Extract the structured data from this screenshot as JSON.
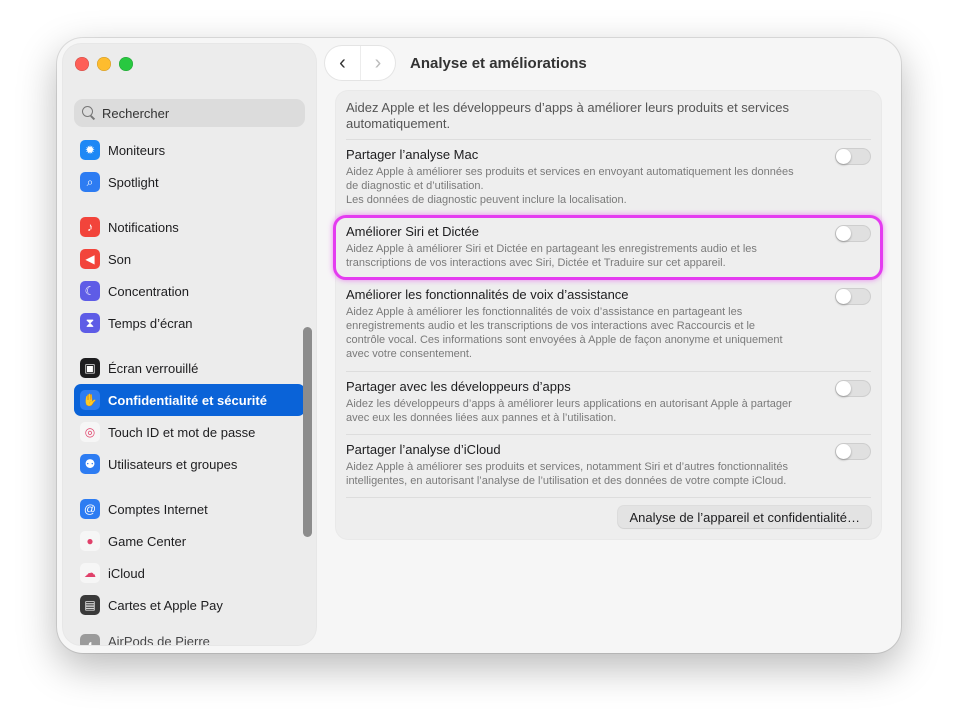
{
  "window": {
    "title": "Analyse et améliorations"
  },
  "search": {
    "placeholder": "Rechercher"
  },
  "sidebar": {
    "groups": [
      [
        {
          "label": "Moniteurs",
          "icon": "sun-icon",
          "color": "#1e88f5",
          "glyph": "✹"
        },
        {
          "label": "Spotlight",
          "icon": "spotlight-icon",
          "color": "#2d7cf2",
          "glyph": "⌕"
        }
      ],
      [
        {
          "label": "Notifications",
          "icon": "bell-icon",
          "color": "#f2443b",
          "glyph": "♪"
        },
        {
          "label": "Son",
          "icon": "speaker-icon",
          "color": "#f2443b",
          "glyph": "◀"
        },
        {
          "label": "Concentration",
          "icon": "moon-icon",
          "color": "#5e5ce6",
          "glyph": "☾"
        },
        {
          "label": "Temps d’écran",
          "icon": "hourglass-icon",
          "color": "#5e5ce6",
          "glyph": "⧗"
        }
      ],
      [
        {
          "label": "Écran verrouillé",
          "icon": "lock-icon",
          "color": "#1d1d1f",
          "glyph": "▣"
        },
        {
          "label": "Confidentialité et sécurité",
          "icon": "hand-icon",
          "color": "#2d7cf2",
          "glyph": "✋",
          "selected": true
        },
        {
          "label": "Touch ID et mot de passe",
          "icon": "fingerprint-icon",
          "color": "#f6f6f6",
          "glyph": "◎"
        },
        {
          "label": "Utilisateurs et groupes",
          "icon": "users-icon",
          "color": "#2d7cf2",
          "glyph": "⚉"
        }
      ],
      [
        {
          "label": "Comptes Internet",
          "icon": "at-icon",
          "color": "#2d7cf2",
          "glyph": "@"
        },
        {
          "label": "Game Center",
          "icon": "game-center-icon",
          "color": "#f6f6f6",
          "glyph": "●"
        },
        {
          "label": "iCloud",
          "icon": "cloud-icon",
          "color": "#f6f6f6",
          "glyph": "☁"
        },
        {
          "label": "Cartes et Apple Pay",
          "icon": "wallet-icon",
          "color": "#3a3a3a",
          "glyph": "▤"
        }
      ]
    ],
    "partial_item": {
      "label": "AirPods de Pierre",
      "icon": "airpods-icon",
      "color": "#888888",
      "glyph": "◖"
    }
  },
  "content": {
    "intro": "Aidez Apple et les développeurs d’apps à améliorer leurs produits et services automatiquement.",
    "rows": [
      {
        "title": "Partager l’analyse Mac",
        "desc": "Aidez Apple à améliorer ses produits et services en envoyant automatiquement les données de diagnostic et d’utilisation.\nLes données de diagnostic peuvent inclure la localisation.",
        "enabled": false
      },
      {
        "title": "Améliorer Siri et Dictée",
        "desc": "Aidez Apple à améliorer Siri et Dictée en partageant les enregistrements audio et les transcriptions de vos interactions avec Siri, Dictée et Traduire sur cet appareil.",
        "enabled": false
      },
      {
        "title": "Améliorer les fonctionnalités de voix d’assistance",
        "desc": "Aidez Apple à améliorer les fonctionnalités de voix d’assistance en partageant les enregistrements audio et les transcriptions de vos interactions avec Raccourcis et le contrôle vocal. Ces informations sont envoyées à Apple de façon anonyme et uniquement avec votre consentement.",
        "enabled": false
      },
      {
        "title": "Partager avec les développeurs d’apps",
        "desc": "Aidez les développeurs d’apps à améliorer leurs applications en autorisant Apple à partager avec eux les données liées aux pannes et à l’utilisation.",
        "enabled": false
      },
      {
        "title": "Partager l’analyse d’iCloud",
        "desc": "Aidez Apple à améliorer ses produits et services, notamment Siri et d’autres fonctionnalités intelligentes, en autorisant l’analyse de l’utilisation et des données de votre compte iCloud.",
        "enabled": false
      }
    ],
    "device_button": "Analyse de l’appareil et confidentialité…"
  },
  "accent": "#0a63d8",
  "highlight_color": "#e43cf0"
}
